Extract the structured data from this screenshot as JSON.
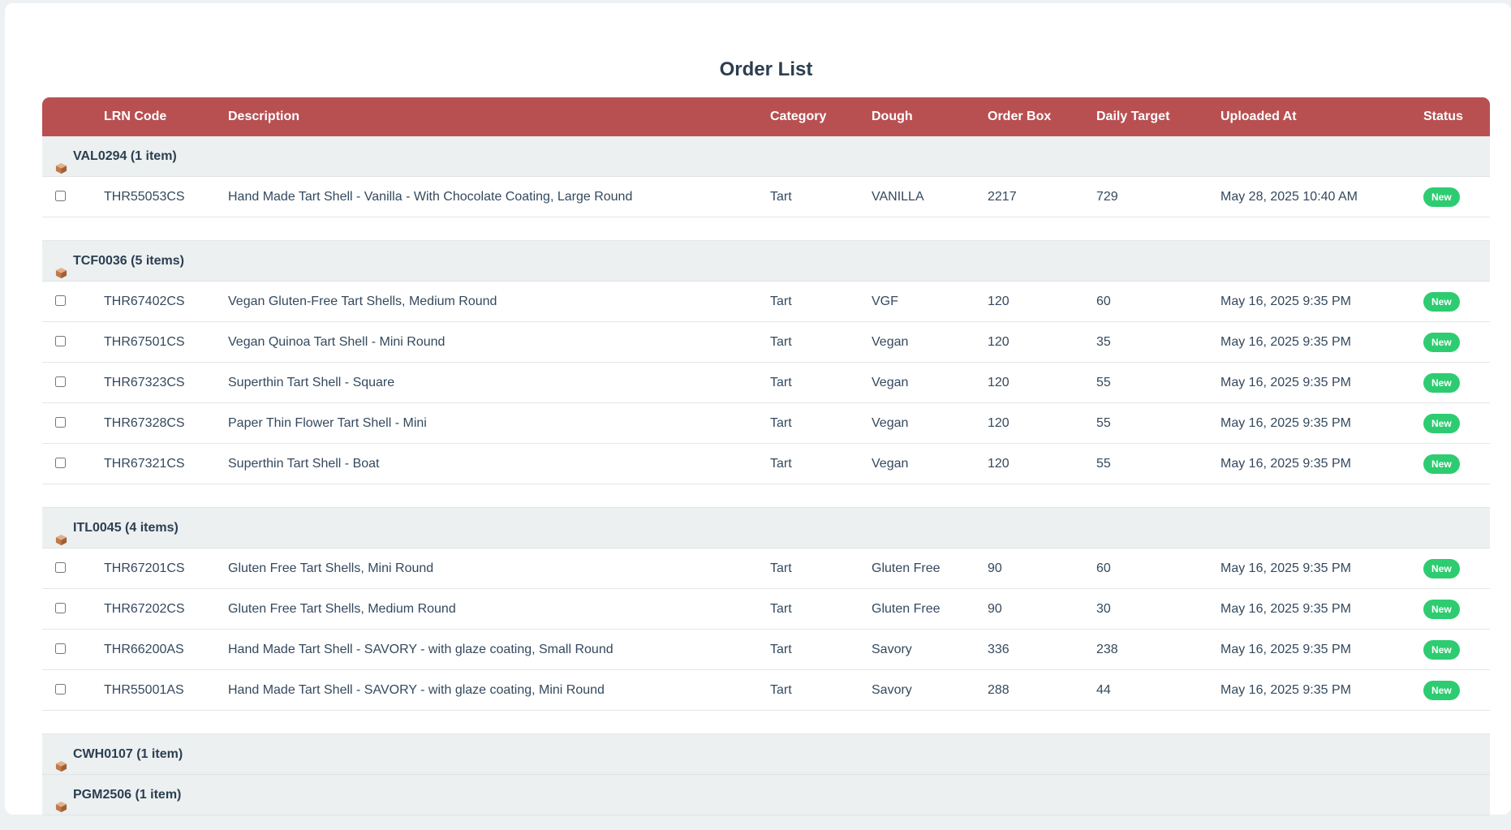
{
  "page": {
    "title": "Order List"
  },
  "colors": {
    "header_bg": "#b85052",
    "badge_bg": "#2ecc71",
    "group_bg": "#ecf0f1"
  },
  "columns": {
    "lrn": "LRN Code",
    "description": "Description",
    "category": "Category",
    "dough": "Dough",
    "order_box": "Order Box",
    "daily_target": "Daily Target",
    "uploaded_at": "Uploaded At",
    "status": "Status"
  },
  "group_icon": "package-icon",
  "groups": [
    {
      "label": "VAL0294 (1 item)",
      "rows": [
        {
          "lrn": "THR55053CS",
          "description": "Hand Made Tart Shell - Vanilla - With Chocolate Coating, Large Round",
          "category": "Tart",
          "dough": "VANILLA",
          "order_box": "2217",
          "daily_target": "729",
          "uploaded_at": "May 28, 2025 10:40 AM",
          "status": "New"
        }
      ]
    },
    {
      "label": "TCF0036 (5 items)",
      "rows": [
        {
          "lrn": "THR67402CS",
          "description": "Vegan Gluten-Free Tart Shells, Medium Round",
          "category": "Tart",
          "dough": "VGF",
          "order_box": "120",
          "daily_target": "60",
          "uploaded_at": "May 16, 2025 9:35 PM",
          "status": "New"
        },
        {
          "lrn": "THR67501CS",
          "description": "Vegan Quinoa Tart Shell - Mini Round",
          "category": "Tart",
          "dough": "Vegan",
          "order_box": "120",
          "daily_target": "35",
          "uploaded_at": "May 16, 2025 9:35 PM",
          "status": "New"
        },
        {
          "lrn": "THR67323CS",
          "description": "Superthin Tart Shell - Square",
          "category": "Tart",
          "dough": "Vegan",
          "order_box": "120",
          "daily_target": "55",
          "uploaded_at": "May 16, 2025 9:35 PM",
          "status": "New"
        },
        {
          "lrn": "THR67328CS",
          "description": "Paper Thin Flower Tart Shell - Mini",
          "category": "Tart",
          "dough": "Vegan",
          "order_box": "120",
          "daily_target": "55",
          "uploaded_at": "May 16, 2025 9:35 PM",
          "status": "New"
        },
        {
          "lrn": "THR67321CS",
          "description": "Superthin Tart Shell - Boat",
          "category": "Tart",
          "dough": "Vegan",
          "order_box": "120",
          "daily_target": "55",
          "uploaded_at": "May 16, 2025 9:35 PM",
          "status": "New"
        }
      ]
    },
    {
      "label": "ITL0045 (4 items)",
      "rows": [
        {
          "lrn": "THR67201CS",
          "description": "Gluten Free Tart Shells, Mini Round",
          "category": "Tart",
          "dough": "Gluten Free",
          "order_box": "90",
          "daily_target": "60",
          "uploaded_at": "May 16, 2025 9:35 PM",
          "status": "New"
        },
        {
          "lrn": "THR67202CS",
          "description": "Gluten Free Tart Shells, Medium Round",
          "category": "Tart",
          "dough": "Gluten Free",
          "order_box": "90",
          "daily_target": "30",
          "uploaded_at": "May 16, 2025 9:35 PM",
          "status": "New"
        },
        {
          "lrn": "THR66200AS",
          "description": "Hand Made Tart Shell - SAVORY - with glaze coating, Small Round",
          "category": "Tart",
          "dough": "Savory",
          "order_box": "336",
          "daily_target": "238",
          "uploaded_at": "May 16, 2025 9:35 PM",
          "status": "New"
        },
        {
          "lrn": "THR55001AS",
          "description": "Hand Made Tart Shell - SAVORY - with glaze coating, Mini Round",
          "category": "Tart",
          "dough": "Savory",
          "order_box": "288",
          "daily_target": "44",
          "uploaded_at": "May 16, 2025 9:35 PM",
          "status": "New"
        }
      ]
    },
    {
      "label": "CWH0107 (1 item)",
      "rows": []
    },
    {
      "label": "PGM2506 (1 item)",
      "rows": []
    }
  ]
}
